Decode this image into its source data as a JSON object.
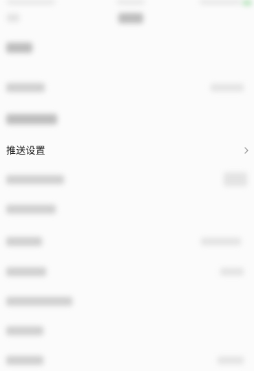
{
  "settings": {
    "push_settings_label": "推送设置"
  },
  "icons": {
    "row_arrow": "chevron-right-icon"
  },
  "colors": {
    "background": "#fbfbfb",
    "text": "#1a1a1a",
    "chevron": "#9a9a9a"
  }
}
